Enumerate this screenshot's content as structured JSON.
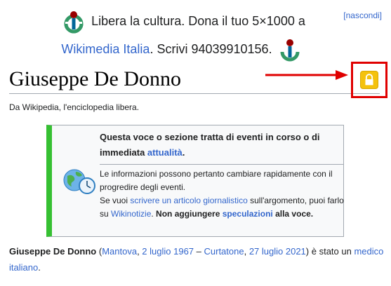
{
  "banner": {
    "line1": "Libera la cultura. Dona il tuo 5×1000 a",
    "link": "Wikimedia Italia",
    "line2_rest": ". Scrivi 94039910156.",
    "hide": "[nascondi]"
  },
  "page": {
    "title": "Giuseppe De Donno",
    "tagline": "Da Wikipedia, l'enciclopedia libera."
  },
  "notice": {
    "heading_text": "Questa voce o sezione tratta di eventi in corso o di immediata ",
    "heading_link": "attualità",
    "heading_end": ".",
    "body1": "Le informazioni possono pertanto cambiare rapidamente con il progredire degli eventi.",
    "body2_a": "Se vuoi ",
    "body2_link1": "scrivere un articolo giornalistico",
    "body2_b": " sull'argomento, puoi farlo su ",
    "body2_link2": "Wikinotizie",
    "body2_c": ". ",
    "body2_bold1": "Non aggiungere ",
    "body2_link3": "speculazioni",
    "body2_bold2": " alla voce."
  },
  "intro": {
    "subject": "Giuseppe De Donno",
    "paren_open": " (",
    "birthplace": "Mantova",
    "birthdate": "2 luglio 1967",
    "dash": " – ",
    "deathplace": "Curtatone",
    "deathdate": "27 luglio 2021",
    "rest": ") è stato un ",
    "profession": "medico italiano",
    "end": "."
  },
  "colors": {
    "link": "#3366cc",
    "notice_accent": "#36c032",
    "annotation_red": "#e00000",
    "lock_yellow": "#f4c20d"
  }
}
